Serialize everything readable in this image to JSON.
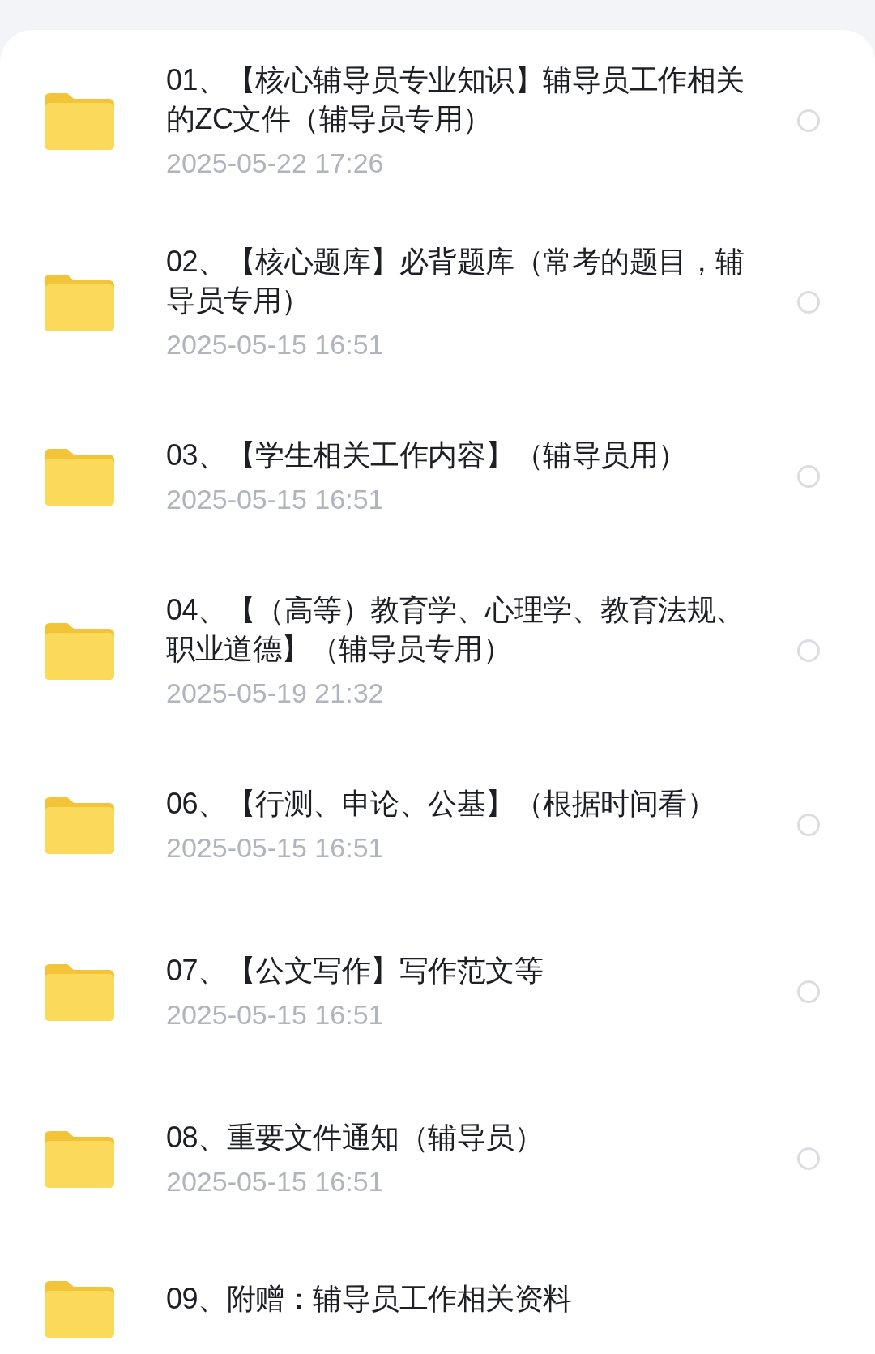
{
  "files": [
    {
      "name": "01、【核心辅导员专业知识】辅导员工作相关的ZC文件（辅导员专用）",
      "date": "2025-05-22  17:26",
      "selected": false
    },
    {
      "name": "02、【核心题库】必背题库（常考的题目，辅导员专用）",
      "date": "2025-05-15  16:51",
      "selected": false
    },
    {
      "name": "03、【学生相关工作内容】（辅导员用）",
      "date": "2025-05-15  16:51",
      "selected": false
    },
    {
      "name": "04、【（高等）教育学、心理学、教育法规、职业道德】（辅导员专用）",
      "date": "2025-05-19  21:32",
      "selected": false
    },
    {
      "name": "06、【行测、申论、公基】（根据时间看）",
      "date": "2025-05-15  16:51",
      "selected": false
    },
    {
      "name": "07、【公文写作】写作范文等",
      "date": "2025-05-15  16:51",
      "selected": false
    },
    {
      "name": "08、重要文件通知（辅导员）",
      "date": "2025-05-15  16:51",
      "selected": false
    },
    {
      "name": "09、附赠：辅导员工作相关资料"
    }
  ]
}
